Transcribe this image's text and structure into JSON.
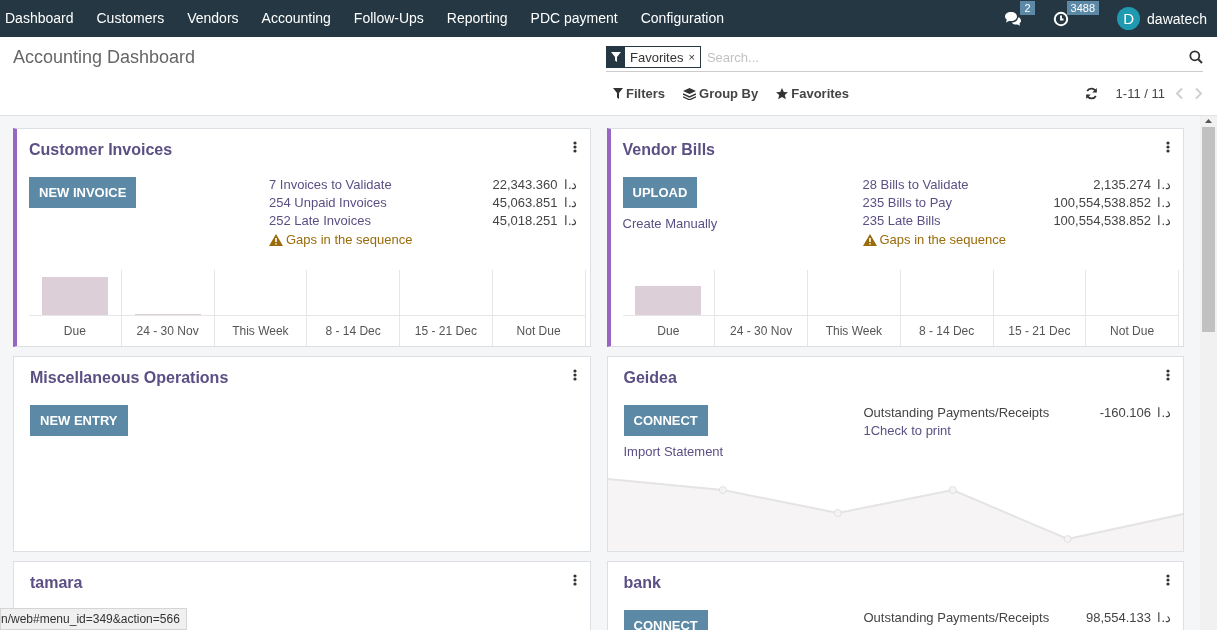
{
  "navbar": {
    "menu": [
      "Dashboard",
      "Customers",
      "Vendors",
      "Accounting",
      "Follow-Ups",
      "Reporting",
      "PDC payment",
      "Configuration"
    ],
    "messages_badge": "2",
    "activities_badge": "3488",
    "avatar_letter": "D",
    "user": "dawatech"
  },
  "control_panel": {
    "title": "Accounting Dashboard",
    "facet": {
      "label": "Favorites",
      "remove": "×"
    },
    "search": {
      "placeholder": "Search..."
    },
    "buttons": [
      {
        "kind": "filter",
        "label": "Filters"
      },
      {
        "kind": "group",
        "label": "Group By"
      },
      {
        "kind": "star",
        "label": "Favorites"
      }
    ],
    "pager": "1-11 / 11",
    "pager_prev_disabled": true,
    "pager_next_disabled": true
  },
  "cards": [
    {
      "kind": "sale",
      "title": "Customer Invoices",
      "button": "NEW INVOICE",
      "stats": [
        {
          "kind": "link",
          "label": "7 Invoices to Validate",
          "amount": "22,343.360",
          "currency": "د.ا"
        },
        {
          "kind": "link",
          "label": "254 Unpaid Invoices",
          "amount": "45,063.851",
          "currency": "د.ا"
        },
        {
          "kind": "link",
          "label": "252 Late Invoices",
          "amount": "45,018.251",
          "currency": "د.ا"
        }
      ],
      "warning": "Gaps in the sequence",
      "chart_labels": [
        "Due",
        "24 - 30 Nov",
        "This Week",
        "8 - 14 Dec",
        "15 - 21 Dec",
        "Not Due"
      ]
    },
    {
      "kind": "purchase",
      "title": "Vendor Bills",
      "button": "UPLOAD",
      "link": "Create Manually",
      "stats": [
        {
          "kind": "link",
          "label": "28 Bills to Validate",
          "amount": "2,135.274",
          "currency": "د.ا"
        },
        {
          "kind": "link",
          "label": "235 Bills to Pay",
          "amount": "100,554,538.852",
          "currency": "د.ا"
        },
        {
          "kind": "link",
          "label": "235 Late Bills",
          "amount": "100,554,538.852",
          "currency": "د.ا"
        }
      ],
      "warning": "Gaps in the sequence",
      "chart_labels": [
        "Due",
        "24 - 30 Nov",
        "This Week",
        "8 - 14 Dec",
        "15 - 21 Dec",
        "Not Due"
      ]
    },
    {
      "kind": "general",
      "title": "Miscellaneous Operations",
      "button": "NEW ENTRY"
    },
    {
      "kind": "bank",
      "title": "Geidea",
      "button": "CONNECT",
      "link": "Import Statement",
      "stats": [
        {
          "kind": "plain",
          "label": "Outstanding Payments/Receipts",
          "amount": "-160.106",
          "currency": "د.ا"
        },
        {
          "kind": "link",
          "label": "1Check to print"
        }
      ]
    },
    {
      "kind": "general",
      "title": "tamara"
    },
    {
      "kind": "bank",
      "title": "bank",
      "button": "CONNECT",
      "stats": [
        {
          "kind": "plain",
          "label": "Outstanding Payments/Receipts",
          "amount": "98,554.133",
          "currency": "د.ا"
        }
      ]
    }
  ],
  "status_url": "n/web#menu_id=349&action=566"
}
